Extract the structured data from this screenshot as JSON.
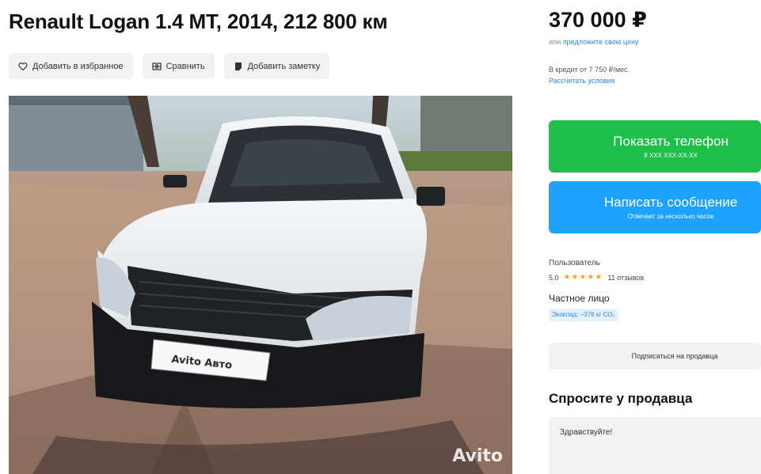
{
  "listing": {
    "title": "Renault Logan 1.4 MT, 2014, 212 800 км"
  },
  "actions": [
    {
      "label": "Добавить в избранное",
      "icon": "heart-icon"
    },
    {
      "label": "Сравнить",
      "icon": "compare-icon"
    },
    {
      "label": "Добавить заметку",
      "icon": "note-icon"
    }
  ],
  "photo": {
    "plate_text": "Avito Авто",
    "watermark": "Avito"
  },
  "sidebar": {
    "price": "370 000 ₽",
    "offer_prefix": "или ",
    "offer_link": "предложите свою цену",
    "credit": "В кредит от 7 750 ₽/мес.",
    "credit_link": "Рассчитать условия",
    "phone_button": {
      "label": "Показать телефон",
      "sub": "8 XXX XXX-XX-XX"
    },
    "message_button": {
      "label": "Написать сообщение",
      "sub": "Отвечает за несколько часов"
    },
    "seller": {
      "label": "Пользователь",
      "rating": "5.0",
      "stars": "★★★★★",
      "reviews": "11 отзывов",
      "type": "Частное лицо",
      "badge": "Экоклад: −376 кг CO₂"
    },
    "subscribe_label": "Подписаться на продавца",
    "ask_title": "Спросите у продавца",
    "ask_placeholder": "Здравствуйте!"
  },
  "colors": {
    "green": "#1fbf4b",
    "blue": "#1fa2ff",
    "link": "#2e86d4"
  }
}
